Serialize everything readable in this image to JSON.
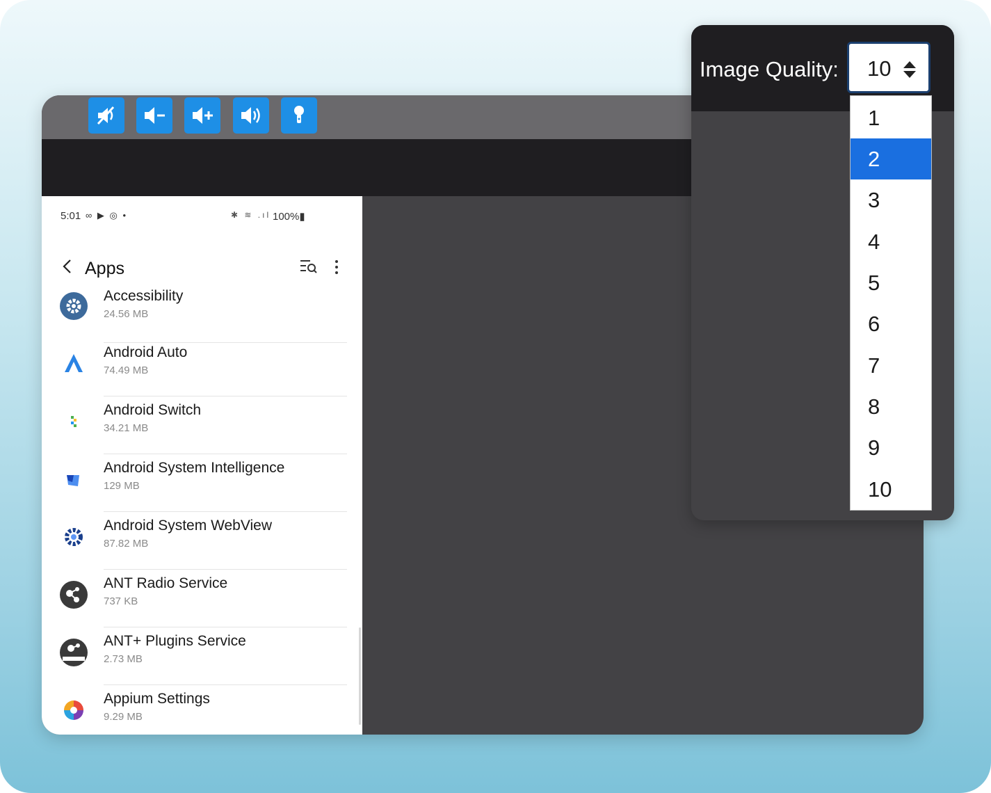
{
  "toolbar": {
    "buttons": [
      {
        "name": "mute-button",
        "icon": "mute-icon"
      },
      {
        "name": "volume-down-button",
        "icon": "volume-down-icon"
      },
      {
        "name": "volume-up-button",
        "icon": "volume-up-icon"
      },
      {
        "name": "volume-button",
        "icon": "volume-icon"
      },
      {
        "name": "microphone-button",
        "icon": "microphone-icon"
      }
    ],
    "accent_color": "#1e8fe6"
  },
  "phone": {
    "status_bar": {
      "time": "5:01",
      "left_icons": "∞ ▶ ◎ •",
      "right_icons": "✱ ≋ .ıl",
      "battery": "100%▮"
    },
    "app_bar": {
      "title": "Apps"
    },
    "apps": [
      {
        "name": "Accessibility",
        "size": "24.56 MB",
        "icon": "gear-icon",
        "icon_bg": "#3d6a9b"
      },
      {
        "name": "Android Auto",
        "size": "74.49 MB",
        "icon": "android-auto-icon",
        "icon_bg": "#ffffff"
      },
      {
        "name": "Android Switch",
        "size": "34.21 MB",
        "icon": "android-switch-icon",
        "icon_bg": "#ffffff"
      },
      {
        "name": "Android System Intelligence",
        "size": "129 MB",
        "icon": "system-intelligence-icon",
        "icon_bg": "#ffffff"
      },
      {
        "name": "Android System WebView",
        "size": "87.82 MB",
        "icon": "webview-gear-icon",
        "icon_bg": "#ffffff"
      },
      {
        "name": "ANT Radio Service",
        "size": "737 KB",
        "icon": "ant-radio-icon",
        "icon_bg": "#3a3a3a"
      },
      {
        "name": "ANT+ Plugins Service",
        "size": "2.73 MB",
        "icon": "ant-plugins-icon",
        "icon_bg": "#3a3a3a"
      },
      {
        "name": "Appium Settings",
        "size": "9.29 MB",
        "icon": "appium-icon",
        "icon_bg": "#ffffff"
      }
    ]
  },
  "image_quality": {
    "label": "Image Quality:",
    "selected_value": "10",
    "highlighted_option": "2",
    "options": [
      "1",
      "2",
      "3",
      "4",
      "5",
      "6",
      "7",
      "8",
      "9",
      "10"
    ],
    "highlight_color": "#1a6fe0"
  }
}
